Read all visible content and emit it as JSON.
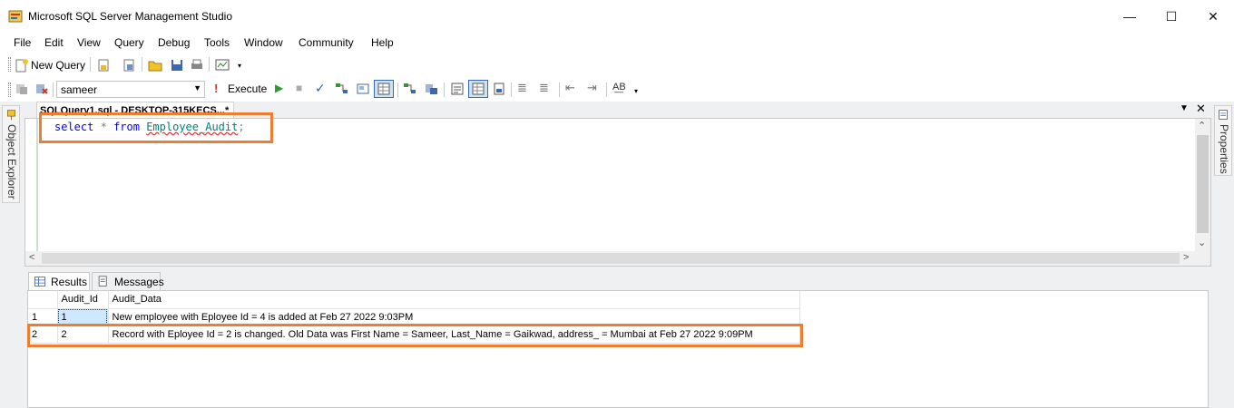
{
  "window": {
    "title": "Microsoft SQL Server Management Studio",
    "controls": {
      "minimize": "—",
      "maximize": "☐",
      "close": "✕"
    }
  },
  "menu": [
    "File",
    "Edit",
    "View",
    "Query",
    "Debug",
    "Tools",
    "Window",
    "Community",
    "Help"
  ],
  "toolbar": {
    "new_query_label": "New Query",
    "database": "sameer",
    "execute_label": "Execute"
  },
  "side_panels": {
    "left": "Object Explorer",
    "right": "Properties"
  },
  "document": {
    "tab_title": "SQLQuery1.sql - DESKTOP-315KECS...*",
    "code": {
      "kw_select": "select",
      "star": "*",
      "kw_from": "from",
      "table": "Employee_Audit",
      "semicolon": ";"
    }
  },
  "results": {
    "tabs": [
      "Results",
      "Messages"
    ],
    "columns": [
      "Audit_Id",
      "Audit_Data"
    ],
    "rows": [
      {
        "num": "1",
        "audit_id": "1",
        "audit_data": "New employee with Eployee Id = 4 is added at Feb 27 2022  9:03PM"
      },
      {
        "num": "2",
        "audit_id": "2",
        "audit_data": "Record with Eployee Id = 2 is changed. Old Data was First Name = Sameer, Last_Name = Gaikwad, address_ = Mumbai at Feb 27 2022  9:09PM"
      }
    ]
  },
  "colors": {
    "highlight": "#ed7d31",
    "keyword": "#0000ff",
    "table_name": "#008080",
    "selection": "#cde8ff"
  }
}
